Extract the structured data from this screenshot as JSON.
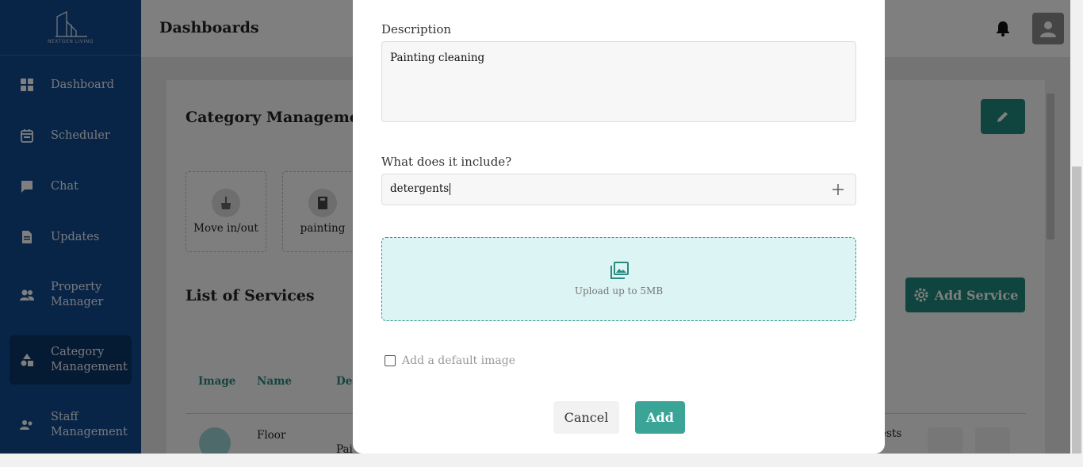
{
  "app": {
    "logo_text": "NEXTGEN LIVING",
    "header_title": "Dashboards"
  },
  "sidebar": {
    "items": [
      {
        "label": "Dashboard",
        "icon": "grid-icon"
      },
      {
        "label": "Scheduler",
        "icon": "calendar-icon"
      },
      {
        "label": "Chat",
        "icon": "chat-bubble-icon"
      },
      {
        "label": "Updates",
        "icon": "document-icon"
      },
      {
        "label": "Property Manager",
        "icon": "people-icon"
      },
      {
        "label": "Category Management",
        "icon": "shapes-icon",
        "active": true
      },
      {
        "label": "Staff Management",
        "icon": "staff-icon"
      }
    ]
  },
  "main": {
    "category_title": "Category Management",
    "categories": [
      {
        "name": "Move in/out",
        "icon": "broom-icon"
      },
      {
        "name": "painting",
        "icon": "book-icon"
      }
    ],
    "services_title": "List of Services",
    "add_service_label": "Add Service",
    "table_headers": [
      "Image",
      "Name",
      "Des"
    ],
    "rows": [
      {
        "name": "Floor",
        "desc": "Pai",
        "extra": "ests"
      }
    ]
  },
  "modal": {
    "description_label": "Description",
    "description_value": "Painting cleaning",
    "include_label": "What does it include?",
    "include_value": "detergents",
    "upload_text": "Upload up to 5MB",
    "default_image_label": "Add a default image",
    "default_image_checked": false,
    "cancel_label": "Cancel",
    "add_label": "Add"
  },
  "colors": {
    "sidebar": "#104a8e",
    "accent": "#1f8a7c",
    "upload_bg": "#ddf4f4"
  }
}
